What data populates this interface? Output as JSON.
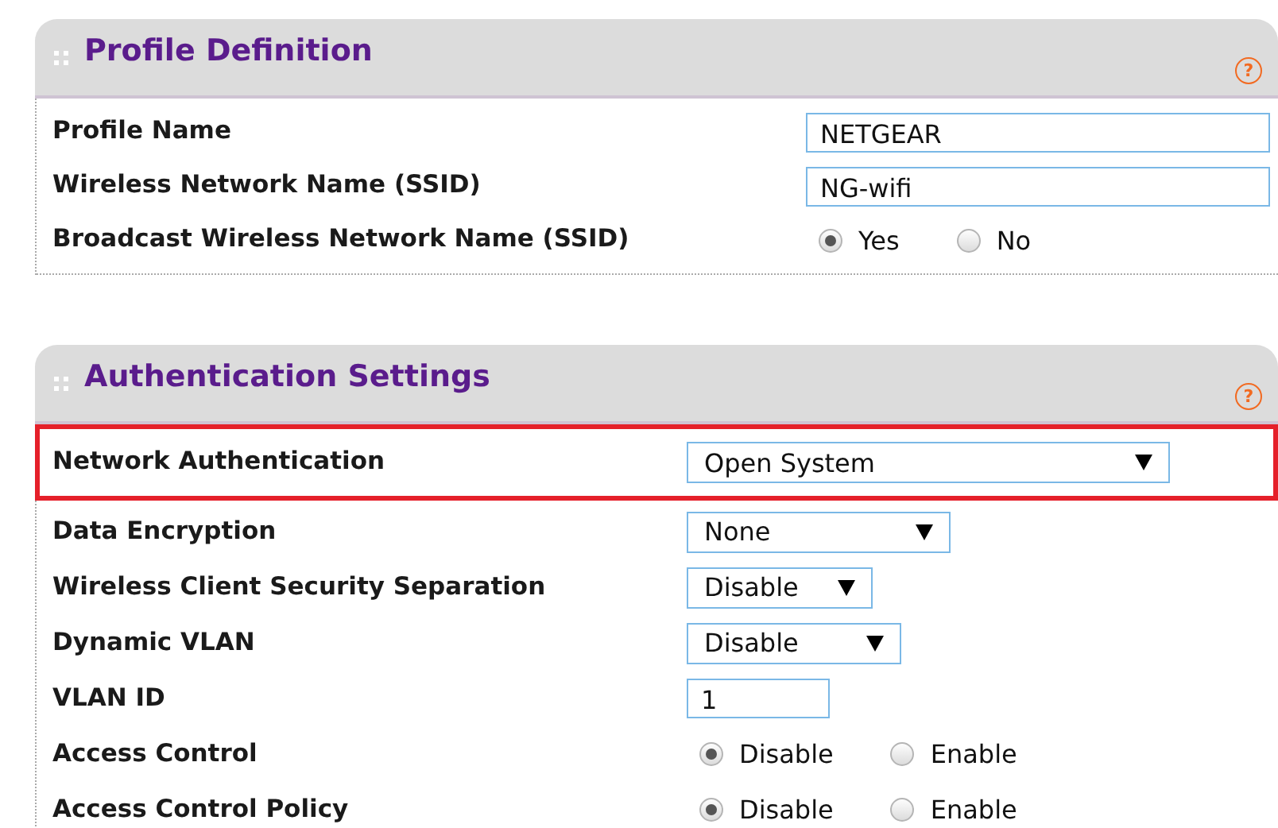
{
  "sections": [
    {
      "title": "Profile Definition",
      "help": "?",
      "rows": [
        {
          "kind": "text",
          "label": "Profile Name",
          "value": "NETGEAR",
          "highlighted": false
        },
        {
          "kind": "text",
          "label": "Wireless Network Name (SSID)",
          "value": "NG-wifi",
          "highlighted": false
        },
        {
          "kind": "radio",
          "label": "Broadcast Wireless Network Name (SSID)",
          "highlighted": false,
          "options": [
            {
              "label": "Yes",
              "selected": true
            },
            {
              "label": "No",
              "selected": false
            }
          ]
        }
      ]
    },
    {
      "title": "Authentication Settings",
      "help": "?",
      "rows": [
        {
          "kind": "select",
          "label": "Network Authentication",
          "value": "Open System",
          "highlighted": true
        },
        {
          "kind": "select",
          "label": "Data Encryption",
          "value": "None",
          "highlighted": false
        },
        {
          "kind": "select",
          "label": "Wireless Client Security Separation",
          "value": "Disable",
          "highlighted": false
        },
        {
          "kind": "select",
          "label": "Dynamic VLAN",
          "value": "Disable",
          "highlighted": false
        },
        {
          "kind": "text",
          "label": "VLAN ID",
          "value": "1",
          "highlighted": false
        },
        {
          "kind": "radio",
          "label": "Access Control",
          "highlighted": false,
          "options": [
            {
              "label": "Disable",
              "selected": true
            },
            {
              "label": "Enable",
              "selected": false
            }
          ]
        },
        {
          "kind": "radio",
          "label": "Access Control Policy",
          "highlighted": false,
          "options": [
            {
              "label": "Disable",
              "selected": true
            },
            {
              "label": "Enable",
              "selected": false
            }
          ]
        }
      ]
    }
  ]
}
